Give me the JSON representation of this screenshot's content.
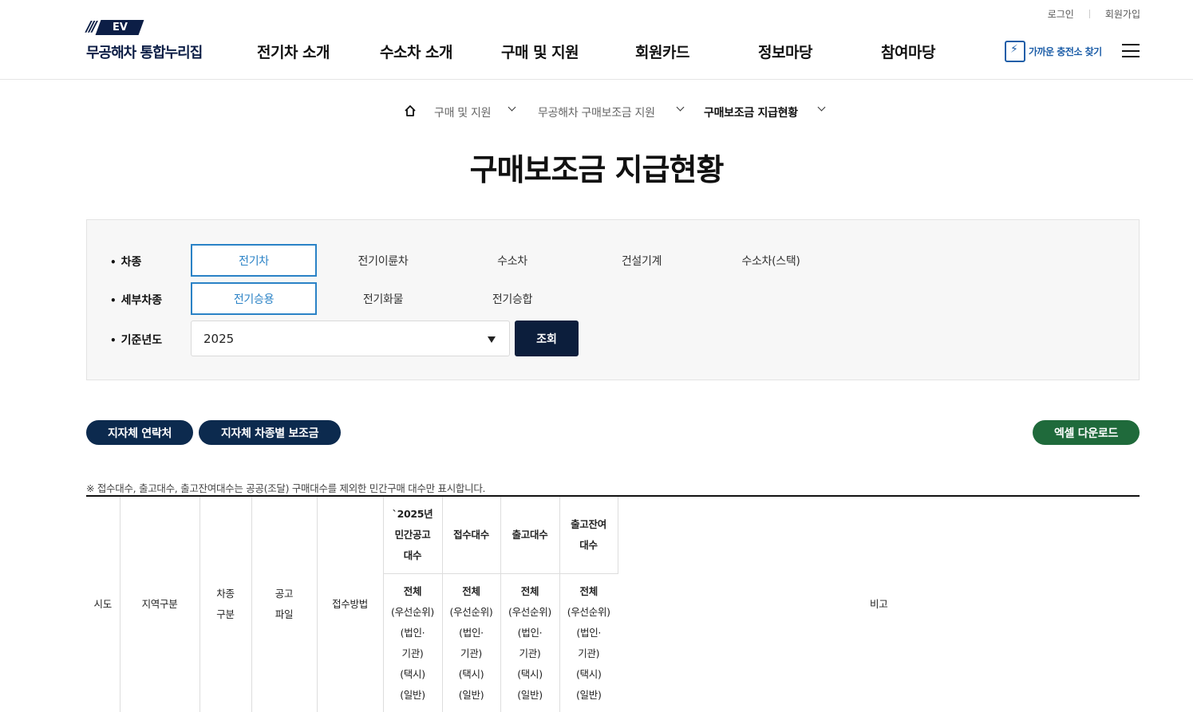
{
  "header": {
    "util": {
      "login": "로그인",
      "signup": "회원가입"
    },
    "logo": {
      "mark": "EV",
      "text": "무공해차 통합누리집"
    },
    "nav": [
      "전기차 소개",
      "수소차 소개",
      "구매 및 지원",
      "회원카드",
      "정보마당",
      "참여마당"
    ],
    "station_link": "가까운 충전소 찾기"
  },
  "breadcrumb": [
    "구매 및 지원",
    "무공해차 구매보조금 지원",
    "구매보조금 지급현황"
  ],
  "page_title": "구매보조금 지급현황",
  "filters": {
    "vehicle_type": {
      "label": "차종",
      "options": [
        "전기차",
        "전기이륜차",
        "수소차",
        "건설기계",
        "수소차(스택)"
      ],
      "selected": "전기차"
    },
    "detail_type": {
      "label": "세부차종",
      "options": [
        "전기승용",
        "전기화물",
        "전기승합"
      ],
      "selected": "전기승용"
    },
    "year": {
      "label": "기준년도",
      "value": "2025"
    },
    "search_button": "조회"
  },
  "buttons": {
    "contact": "지자체 연락처",
    "subsidy": "지자체 차종별 보조금",
    "excel": "엑셀 다운로드"
  },
  "notice": "※ 접수대수, 출고대수, 출고잔여대수는 공공(조달) 구매대수를 제외한 민간구매 대수만 표시합니다.",
  "table": {
    "headers": {
      "sido": "시도",
      "region": "지역구분",
      "vehicle": [
        "차종",
        "구분"
      ],
      "file": [
        "공고",
        "파일"
      ],
      "method": "접수방법",
      "announce": [
        "`2025년",
        "민간공고",
        "대수"
      ],
      "received": "접수대수",
      "released": "출고대수",
      "remaining": [
        "출고잔여",
        "대수"
      ],
      "note": "비고"
    },
    "sub_header": [
      "전체",
      "(우선순위)",
      "(법인·",
      "기관)",
      "(택시)",
      "(일반)"
    ]
  }
}
